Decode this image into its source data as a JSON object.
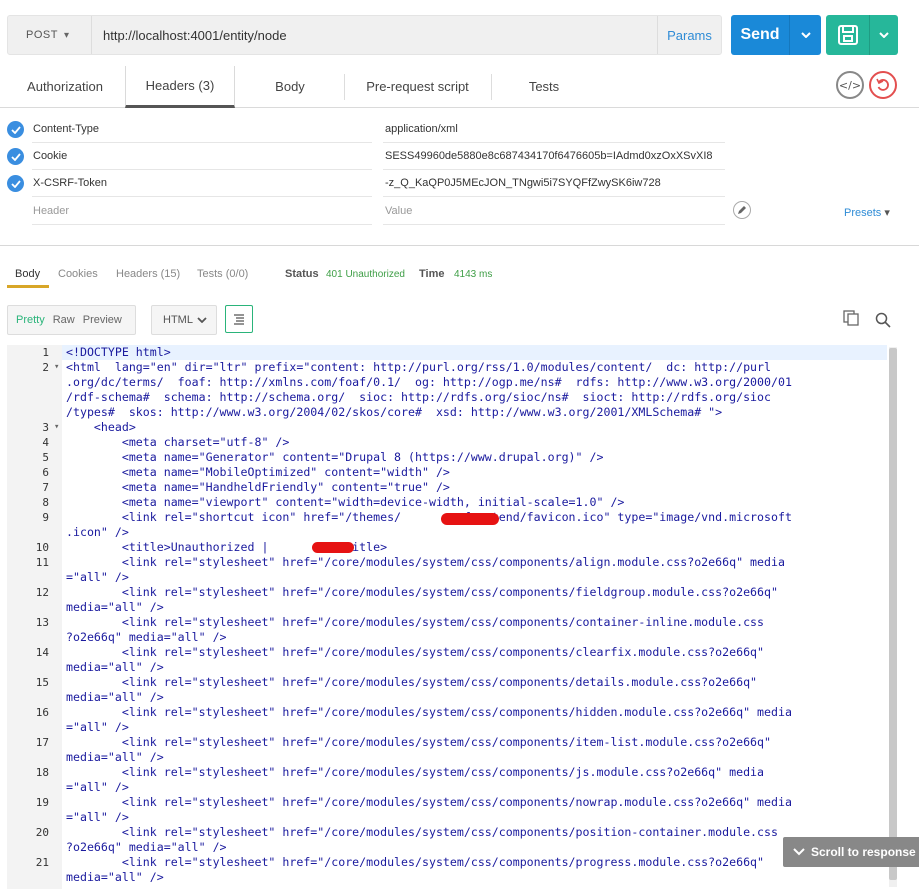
{
  "request": {
    "method": "POST",
    "url": "http://localhost:4001/entity/node",
    "params_label": "Params",
    "send_label": "Send"
  },
  "tabs": [
    "Authorization",
    "Headers (3)",
    "Body",
    "Pre-request script",
    "Tests"
  ],
  "active_tab": "Headers (3)",
  "headers": [
    {
      "key": "Content-Type",
      "value": "application/xml",
      "enabled": true
    },
    {
      "key": "Cookie",
      "value": "SESS49960de5880e8c687434170f6476605b=IAdmd0xzOxXSvXI8",
      "enabled": true
    },
    {
      "key": "X-CSRF-Token",
      "value": "-z_Q_KaQP0J5MEcJON_TNgwi5i7SYQFfZwySK6iw728",
      "enabled": true
    }
  ],
  "new_header": {
    "key_placeholder": "Header",
    "value_placeholder": "Value"
  },
  "presets_label": "Presets",
  "response": {
    "tabs": [
      "Body",
      "Cookies",
      "Headers (15)",
      "Tests (0/0)"
    ],
    "active_tab": "Body",
    "status_label": "Status",
    "status_value": "401 Unauthorized",
    "time_label": "Time",
    "time_value": "4143 ms",
    "formats": [
      "Pretty",
      "Raw",
      "Preview"
    ],
    "active_format": "Pretty",
    "language": "HTML",
    "scroll_label": "Scroll to response"
  },
  "code_lines": [
    {
      "n": "1",
      "fold": "",
      "text": "<!DOCTYPE html>"
    },
    {
      "n": "2",
      "fold": "▾",
      "text": "<html  lang=\"en\" dir=\"ltr\" prefix=\"content: http://purl.org/rss/1.0/modules/content/  dc: http://purl"
    },
    {
      "n": "",
      "fold": "",
      "text": ".org/dc/terms/  foaf: http://xmlns.com/foaf/0.1/  og: http://ogp.me/ns#  rdfs: http://www.w3.org/2000/01"
    },
    {
      "n": "",
      "fold": "",
      "text": "/rdf-schema#  schema: http://schema.org/  sioc: http://rdfs.org/sioc/ns#  sioct: http://rdfs.org/sioc"
    },
    {
      "n": "",
      "fold": "",
      "text": "/types#  skos: http://www.w3.org/2004/02/skos/core#  xsd: http://www.w3.org/2001/XMLSchema# \">"
    },
    {
      "n": "3",
      "fold": "▾",
      "text": "    <head>"
    },
    {
      "n": "4",
      "fold": "",
      "text": "        <meta charset=\"utf-8\" />"
    },
    {
      "n": "5",
      "fold": "",
      "text": "        <meta name=\"Generator\" content=\"Drupal 8 (https://www.drupal.org)\" />"
    },
    {
      "n": "6",
      "fold": "",
      "text": "        <meta name=\"MobileOptimized\" content=\"width\" />"
    },
    {
      "n": "7",
      "fold": "",
      "text": "        <meta name=\"HandheldFriendly\" content=\"true\" />"
    },
    {
      "n": "8",
      "fold": "",
      "text": "        <meta name=\"viewport\" content=\"width=device-width, initial-scale=1.0\" />"
    },
    {
      "n": "9",
      "fold": "",
      "text": "        <link rel=\"shortcut icon\" href=\"/themes/        _frontend/favicon.ico\" type=\"image/vnd.microsoft"
    },
    {
      "n": "",
      "fold": "",
      "text": ".icon\" />"
    },
    {
      "n": "10",
      "fold": "",
      "text": "        <title>Unauthorized |         </title>"
    },
    {
      "n": "11",
      "fold": "",
      "text": "        <link rel=\"stylesheet\" href=\"/core/modules/system/css/components/align.module.css?o2e66q\" media"
    },
    {
      "n": "",
      "fold": "",
      "text": "=\"all\" />"
    },
    {
      "n": "12",
      "fold": "",
      "text": "        <link rel=\"stylesheet\" href=\"/core/modules/system/css/components/fieldgroup.module.css?o2e66q\""
    },
    {
      "n": "",
      "fold": "",
      "text": "media=\"all\" />"
    },
    {
      "n": "13",
      "fold": "",
      "text": "        <link rel=\"stylesheet\" href=\"/core/modules/system/css/components/container-inline.module.css"
    },
    {
      "n": "",
      "fold": "",
      "text": "?o2e66q\" media=\"all\" />"
    },
    {
      "n": "14",
      "fold": "",
      "text": "        <link rel=\"stylesheet\" href=\"/core/modules/system/css/components/clearfix.module.css?o2e66q\""
    },
    {
      "n": "",
      "fold": "",
      "text": "media=\"all\" />"
    },
    {
      "n": "15",
      "fold": "",
      "text": "        <link rel=\"stylesheet\" href=\"/core/modules/system/css/components/details.module.css?o2e66q\""
    },
    {
      "n": "",
      "fold": "",
      "text": "media=\"all\" />"
    },
    {
      "n": "16",
      "fold": "",
      "text": "        <link rel=\"stylesheet\" href=\"/core/modules/system/css/components/hidden.module.css?o2e66q\" media"
    },
    {
      "n": "",
      "fold": "",
      "text": "=\"all\" />"
    },
    {
      "n": "17",
      "fold": "",
      "text": "        <link rel=\"stylesheet\" href=\"/core/modules/system/css/components/item-list.module.css?o2e66q\""
    },
    {
      "n": "",
      "fold": "",
      "text": "media=\"all\" />"
    },
    {
      "n": "18",
      "fold": "",
      "text": "        <link rel=\"stylesheet\" href=\"/core/modules/system/css/components/js.module.css?o2e66q\" media"
    },
    {
      "n": "",
      "fold": "",
      "text": "=\"all\" />"
    },
    {
      "n": "19",
      "fold": "",
      "text": "        <link rel=\"stylesheet\" href=\"/core/modules/system/css/components/nowrap.module.css?o2e66q\" media"
    },
    {
      "n": "",
      "fold": "",
      "text": "=\"all\" />"
    },
    {
      "n": "20",
      "fold": "",
      "text": "        <link rel=\"stylesheet\" href=\"/core/modules/system/css/components/position-container.module.css"
    },
    {
      "n": "",
      "fold": "",
      "text": "?o2e66q\" media=\"all\" />"
    },
    {
      "n": "21",
      "fold": "",
      "text": "        <link rel=\"stylesheet\" href=\"/core/modules/system/css/components/progress.module.css?o2e66q\""
    },
    {
      "n": "",
      "fold": "",
      "text": "media=\"all\" />"
    }
  ],
  "colors": {
    "send": "#1a89d8",
    "save": "#26b79a",
    "status_ok": "#3e9e46",
    "link": "#2f8cd6"
  }
}
